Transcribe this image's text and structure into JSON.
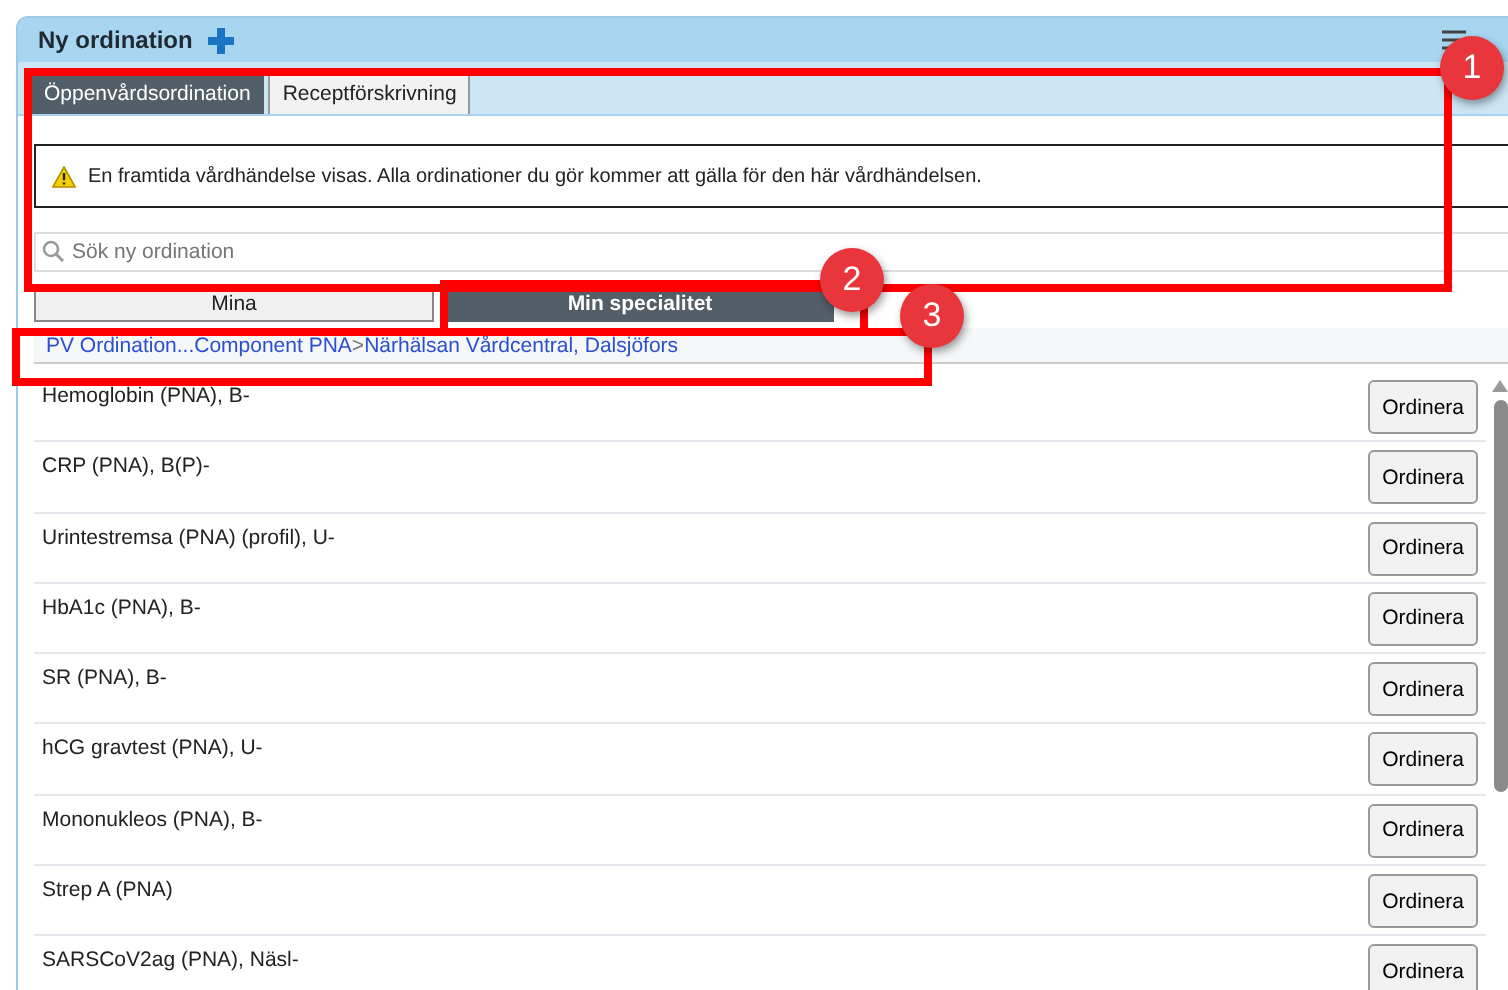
{
  "panel": {
    "title": "Ny ordination"
  },
  "tabs": [
    {
      "label": "Öppenvårdsordination",
      "selected": true
    },
    {
      "label": "Receptförskrivning",
      "selected": false
    }
  ],
  "warning": "En framtida vårdhändelse visas. Alla ordinationer du gör kommer att gälla för den här vårdhändelsen.",
  "search": {
    "placeholder": "Sök ny ordination"
  },
  "toggle": [
    {
      "label": "Mina",
      "selected": false
    },
    {
      "label": "Min specialitet",
      "selected": true
    }
  ],
  "breadcrumb": {
    "items": [
      "PV Ordination...Component PNA",
      "Närhälsan Vårdcentral, Dalsjöfors"
    ],
    "separator": ">"
  },
  "rows": [
    {
      "name": "Hemoglobin (PNA), B-",
      "action": "Ordinera"
    },
    {
      "name": "CRP (PNA), B(P)-",
      "action": "Ordinera"
    },
    {
      "name": "Urintestremsa (PNA) (profil), U-",
      "action": "Ordinera"
    },
    {
      "name": "HbA1c (PNA), B-",
      "action": "Ordinera"
    },
    {
      "name": "SR (PNA), B-",
      "action": "Ordinera"
    },
    {
      "name": "hCG gravtest (PNA), U-",
      "action": "Ordinera"
    },
    {
      "name": "Mononukleos (PNA), B-",
      "action": "Ordinera"
    },
    {
      "name": "Strep A (PNA)",
      "action": "Ordinera"
    },
    {
      "name": "SARSCoV2ag (PNA), Näsl-",
      "action": "Ordinera"
    }
  ],
  "annotations": [
    {
      "label": "1"
    },
    {
      "label": "2"
    },
    {
      "label": "3"
    }
  ]
}
